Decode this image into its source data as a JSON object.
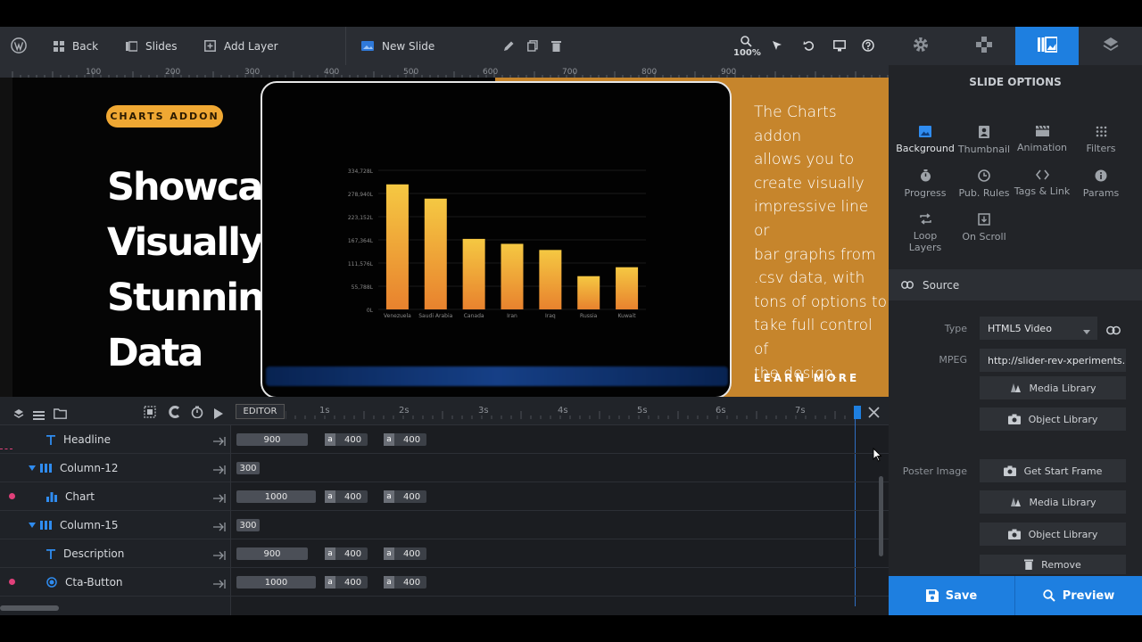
{
  "toolbar": {
    "back_label": "Back",
    "slides_label": "Slides",
    "add_layer_label": "Add Layer",
    "slide_name": "New Slide",
    "zoom": "100%"
  },
  "canvas": {
    "badge": "CHARTS ADDON",
    "headline_lines": [
      "Showcase",
      "Visually",
      "Stunning",
      "Data"
    ],
    "description_lines": [
      "The Charts addon",
      "allows you to",
      "create visually",
      "impressive line or",
      "bar graphs from",
      ".csv data, with",
      "tons of options to",
      "take full control of",
      "the design."
    ],
    "learn_more": "LEARN MORE"
  },
  "ruler": {
    "labels": [
      "100",
      "200",
      "300",
      "400",
      "500",
      "600",
      "700",
      "800",
      "900"
    ]
  },
  "chart_data": {
    "type": "bar",
    "categories": [
      "Venezuela",
      "Saudi Arabia",
      "Canada",
      "Iran",
      "Iraq",
      "Russia",
      "Kuwait"
    ],
    "values": [
      300878,
      266578,
      169709,
      157800,
      143069,
      80000,
      101500
    ],
    "ytick_labels": [
      "0L",
      "55,788L",
      "111,576L",
      "167,364L",
      "223,152L",
      "278,940L",
      "334,728L"
    ],
    "ylim": [
      0,
      334728
    ],
    "bar_colors": {
      "top": "#f5c842",
      "bottom": "#e8822e"
    }
  },
  "timeline": {
    "editor_label": "EDITOR",
    "ticks": [
      "1s",
      "2s",
      "3s",
      "4s",
      "5s",
      "6s",
      "7s"
    ],
    "rows": [
      {
        "label": "Headline",
        "duration": "900",
        "in": "400",
        "out": "400"
      },
      {
        "label": "Column-12",
        "duration": "300"
      },
      {
        "label": "Chart",
        "duration": "1000",
        "in": "400",
        "out": "400"
      },
      {
        "label": "Column-15",
        "duration": "300"
      },
      {
        "label": "Description",
        "duration": "900",
        "in": "400",
        "out": "400"
      },
      {
        "label": "Cta-Button",
        "duration": "1000",
        "in": "400",
        "out": "400"
      }
    ],
    "a_label": "a"
  },
  "panel": {
    "title": "SLIDE OPTIONS",
    "options": [
      "Background",
      "Thumbnail",
      "Animation",
      "Filters",
      "Progress",
      "Pub. Rules",
      "Tags & Link",
      "Params",
      "Loop Layers",
      "On Scroll"
    ],
    "source_label": "Source",
    "type_label": "Type",
    "type_value": "HTML5 Video",
    "mpeg_label": "MPEG",
    "mpeg_value": "http://slider-rev-xperiments.l",
    "media_library": "Media Library",
    "object_library": "Object Library",
    "poster_label": "Poster Image",
    "get_start_frame": "Get Start Frame",
    "remove": "Remove",
    "save": "Save",
    "preview": "Preview"
  },
  "colors": {
    "accent": "#1e7fe0",
    "badge": "#f0a833",
    "orange_panel": "#c6852c"
  }
}
